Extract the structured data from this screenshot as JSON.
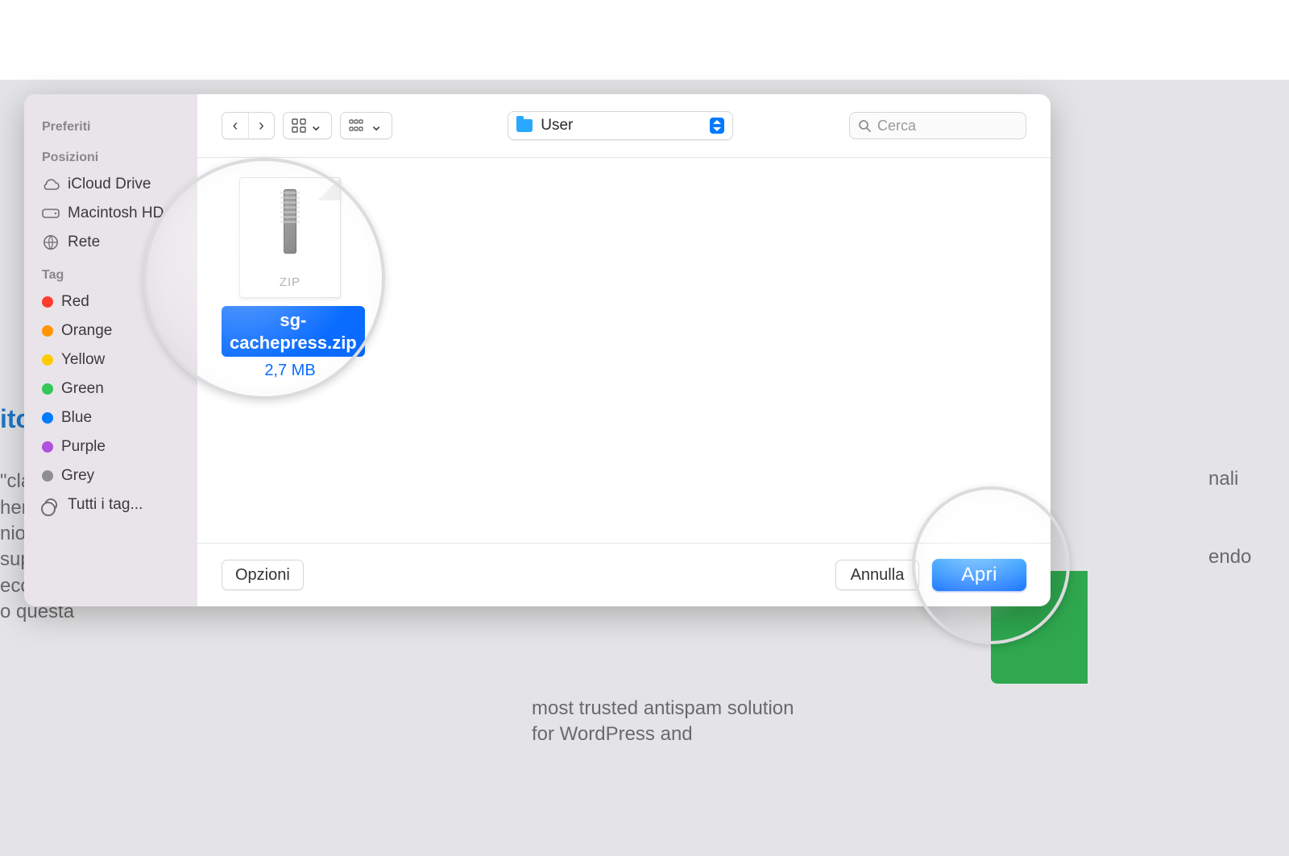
{
  "sidebar": {
    "favorites_header": "Preferiti",
    "locations_header": "Posizioni",
    "locations": {
      "icloud": "iCloud Drive",
      "macintosh": "Macintosh HD",
      "network": "Rete"
    },
    "tags_header": "Tag",
    "tags": [
      {
        "label": "Red",
        "color": "#ff3b30"
      },
      {
        "label": "Orange",
        "color": "#ff9500"
      },
      {
        "label": "Yellow",
        "color": "#ffcc00"
      },
      {
        "label": "Green",
        "color": "#34c759"
      },
      {
        "label": "Blue",
        "color": "#007aff"
      },
      {
        "label": "Purple",
        "color": "#af52de"
      },
      {
        "label": "Grey",
        "color": "#8e8e93"
      }
    ],
    "all_tags": "Tutti i tag..."
  },
  "toolbar": {
    "location": "User",
    "search_placeholder": "Cerca"
  },
  "file": {
    "name": "sg-cachepress.zip",
    "size": "2,7 MB",
    "type_label": "ZIP"
  },
  "buttons": {
    "options": "Opzioni",
    "cancel": "Annulla",
    "open": "Apri"
  },
  "background": {
    "left_fragment": "ito\n\n\"cla\nher\nnio s\nsup\necc e ai plugin\no questa",
    "right_fragment": "nali\n\nendo",
    "below_fragment": "most trusted antispam solution for WordPress and"
  }
}
